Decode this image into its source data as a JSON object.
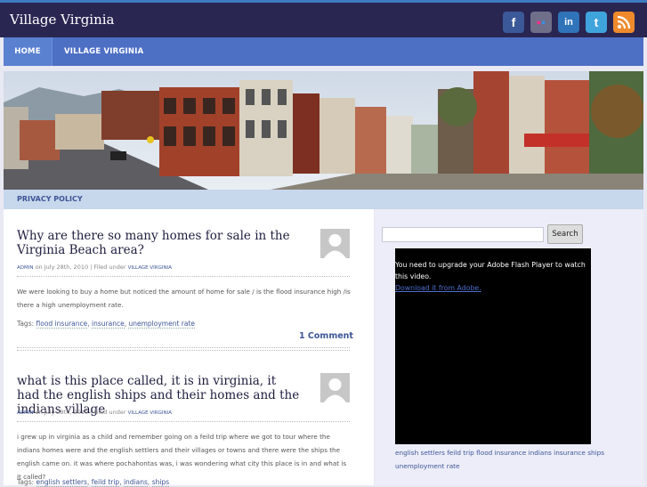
{
  "header": {
    "site_title": "Village Virginia",
    "social": [
      {
        "name": "facebook-icon",
        "glyph": "f",
        "color": "#3b5998"
      },
      {
        "name": "flickr-icon",
        "glyph": "••",
        "color": "#6f6f8a"
      },
      {
        "name": "linkedin-icon",
        "glyph": "in",
        "color": "#2f73b8"
      },
      {
        "name": "twitter-icon",
        "glyph": "t",
        "color": "#3fa4dc"
      },
      {
        "name": "rss-icon",
        "glyph": "≋",
        "color": "#ef8a2c"
      }
    ]
  },
  "nav": {
    "home": "HOME",
    "village": "VILLAGE VIRGINIA"
  },
  "subnav": {
    "privacy": "PRIVACY POLICY"
  },
  "posts": [
    {
      "title": "Why are there so many homes for sale in the Virginia Beach area?",
      "author": "ADMIN",
      "date_text": "on July 28th, 2010 | Filed under",
      "category": "VILLAGE VIRGINIA",
      "body": "We were looking to buy a home but noticed the amount of home for sale / is the flood insurance high /is there a high unemployment rate.",
      "tags_label": "Tags:",
      "tags": [
        "flood insurance",
        "insurance",
        "unemployment rate"
      ],
      "comments": "1 Comment"
    },
    {
      "title": "what is this place called, it is in virginia, it had the english ships and their homes and the indians village",
      "author": "ADMIN",
      "date_text": "on July 28th, 2010 | Filed under",
      "category": "VILLAGE VIRGINIA",
      "body": "i grew up in virginia as a child and remember going on a feild trip where we got to tour where the indians homes were and the english settlers and their villages or towns and there were the ships the english came on. it was where pochahontas was, i was wondering what city this place is in and what is it called?",
      "tags_label": "Tags:",
      "tags": [
        "english settlers",
        "feild trip",
        "indians",
        "ships"
      ]
    }
  ],
  "sidebar": {
    "search_button": "Search",
    "flash_message": "You need to upgrade your Adobe Flash Player to watch this video.",
    "flash_link": "Download it from Adobe.",
    "tags": [
      "english settlers",
      "feild trip",
      "flood insurance",
      "indians",
      "insurance",
      "ships",
      "unemployment rate"
    ]
  },
  "colors": {
    "header_bg": "#2a2652",
    "nav_bg": "#4d6fc4",
    "link": "#3d5597"
  }
}
